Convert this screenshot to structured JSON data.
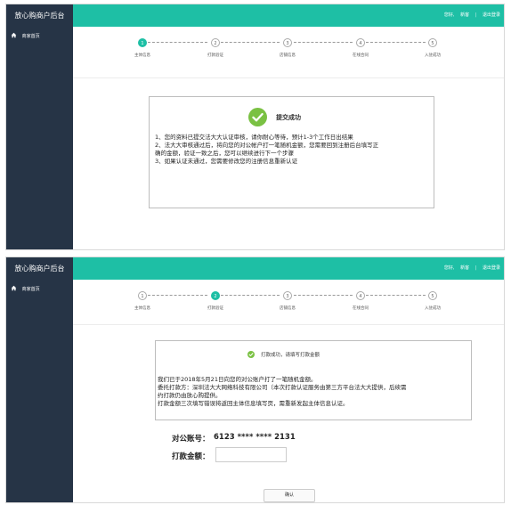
{
  "app": {
    "title": "放心购商户后台",
    "top_links": {
      "user_prefix": "您好,",
      "user_name": "新客",
      "separator": "|",
      "logout": "退出登录"
    },
    "sidebar": {
      "items": [
        {
          "label": "商家首页",
          "icon": "home-icon"
        }
      ]
    }
  },
  "steps": [
    {
      "num": "1",
      "label": "主体信息"
    },
    {
      "num": "2",
      "label": "打款验证"
    },
    {
      "num": "3",
      "label": "店铺信息"
    },
    {
      "num": "4",
      "label": "在线合同"
    },
    {
      "num": "5",
      "label": "入驻成功"
    }
  ],
  "screen1": {
    "active_step": 1,
    "box": {
      "title": "提交成功",
      "icon": "check-circle-icon",
      "lines": [
        "1、您的资料已提交法大大认证审核，请你耐心等待，预计1-3个工作日出结果",
        "2、法大大审核通过后，将向您的对公帐户打一笔随机金额，您需要回到注册后台填写正",
        "确的金额，验证一致之后，您可以继续进行下一个步骤",
        "3、如果认证未通过，您需要修改您的注册信息重新认证"
      ]
    }
  },
  "screen2": {
    "active_step": 2,
    "box": {
      "title": "打款成功，请填写打款金额",
      "icon": "check-circle-icon",
      "lines": [
        "我们已于2018年5月21日向您的对公账户打了一笔随机金额。",
        "委托打款方：深圳法大大网络科技有限公司（本次打款认证服务由第三方平台法大大提供，后续需",
        "约打款仍由放心购提供。",
        "打款金额三次填写错误将返回主体信息填写页，需重新发起主体信息认证。"
      ]
    },
    "account_label": "对公账号：",
    "account_value": "6123 **** **** 2131",
    "amount_label": "打款金额：",
    "amount_value": "",
    "confirm_button": "确认"
  },
  "colors": {
    "accent": "#1ebfa5",
    "sidebar": "#263446",
    "check": "#7ac143"
  }
}
